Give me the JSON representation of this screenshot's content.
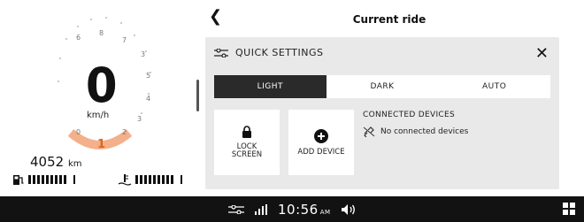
{
  "gauge": {
    "ticks_top": [
      "6",
      "7",
      "8"
    ],
    "ticks_right": [
      "5",
      "4",
      "3"
    ],
    "ticks_bottom": [
      "0",
      "1",
      "2"
    ],
    "speed_value": "0",
    "speed_unit": "km/h",
    "gear_indicator": "1"
  },
  "odometer": {
    "value": "4052",
    "unit": "km"
  },
  "header": {
    "title": "Current ride"
  },
  "quick_settings": {
    "title": "QUICK SETTINGS",
    "theme_options": [
      "LIGHT",
      "DARK",
      "AUTO"
    ],
    "selected_theme": "LIGHT",
    "tiles": [
      {
        "label": "LOCK\nSCREEN",
        "icon": "lock-icon"
      },
      {
        "label": "ADD DEVICE",
        "icon": "plus-circle-icon"
      }
    ],
    "connected_devices": {
      "title": "CONNECTED DEVICES",
      "status": "No connected devices",
      "icon": "disconnected-link-icon"
    }
  },
  "status_bar": {
    "time": "10:56",
    "ampm": "AM",
    "icons": [
      "settings-sliders-icon",
      "signal-icon",
      "volume-icon",
      "grid-icon"
    ]
  },
  "colors": {
    "accent_orange": "#d8661e",
    "bar_dark": "#121212",
    "card_bg": "#e9e9e9"
  }
}
